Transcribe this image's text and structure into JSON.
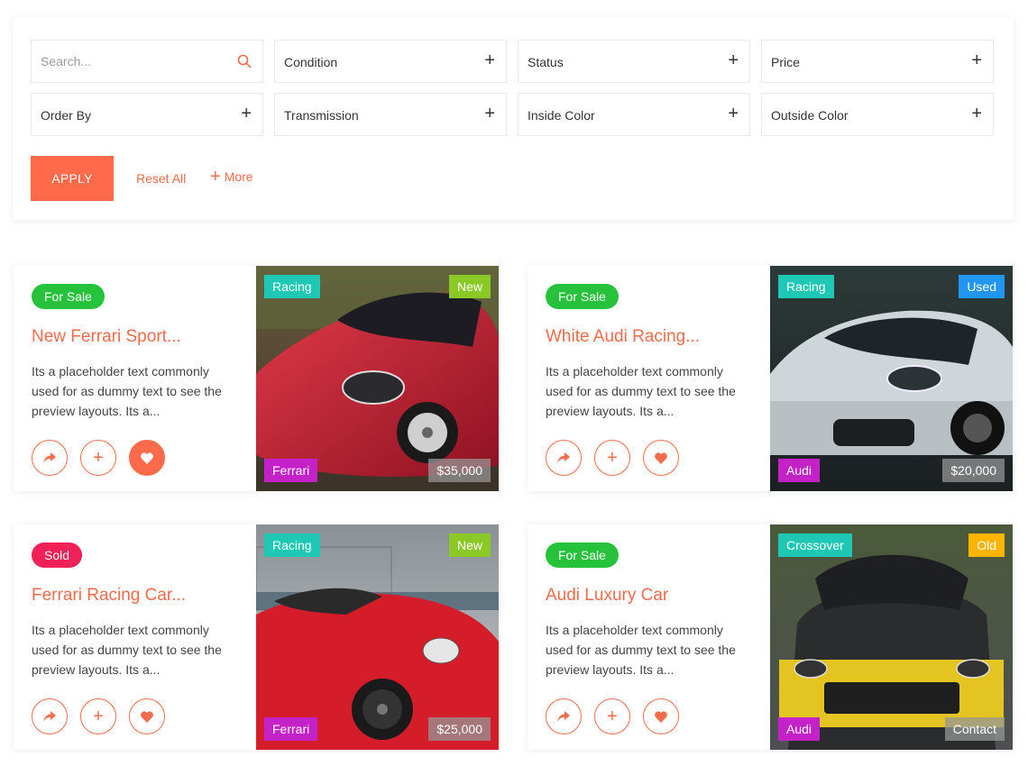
{
  "filters": {
    "search_placeholder": "Search...",
    "dropdowns": [
      "Condition",
      "Status",
      "Price",
      "Order By",
      "Transmission",
      "Inside Color",
      "Outside Color"
    ],
    "apply_label": "APPLY",
    "reset_label": "Reset All",
    "more_label": "More"
  },
  "colors": {
    "accent": "#ff6b4a",
    "for_sale": "#27c23c",
    "sold": "#ef2157",
    "type_tag": "#1fc8b4",
    "brand_tag": "#c521c8",
    "new_tag": "#8ac926",
    "used_tag": "#2196f3",
    "old_tag": "#ffb400"
  },
  "cards": [
    {
      "status": "For Sale",
      "title": "New Ferrari Sport...",
      "description": "Its a placeholder text commonly used for as dummy text to see the preview layouts. Its a...",
      "type_tag": "Racing",
      "condition_tag": "New",
      "brand_tag": "Ferrari",
      "price": "$35,000",
      "favorited": true
    },
    {
      "status": "For Sale",
      "title": "White Audi Racing...",
      "description": "Its a placeholder text commonly used for as dummy text to see the preview layouts. Its a...",
      "type_tag": "Racing",
      "condition_tag": "Used",
      "brand_tag": "Audi",
      "price": "$20,000",
      "favorited": false
    },
    {
      "status": "Sold",
      "title": "Ferrari Racing Car...",
      "description": "Its a placeholder text commonly used for as dummy text to see the preview layouts. Its a...",
      "type_tag": "Racing",
      "condition_tag": "New",
      "brand_tag": "Ferrari",
      "price": "$25,000",
      "favorited": false
    },
    {
      "status": "For Sale",
      "title": "Audi Luxury Car",
      "description": "Its a placeholder text commonly used for as dummy text to see the preview layouts. Its a...",
      "type_tag": "Crossover",
      "condition_tag": "Old",
      "brand_tag": "Audi",
      "price": "Contact",
      "favorited": false
    }
  ]
}
